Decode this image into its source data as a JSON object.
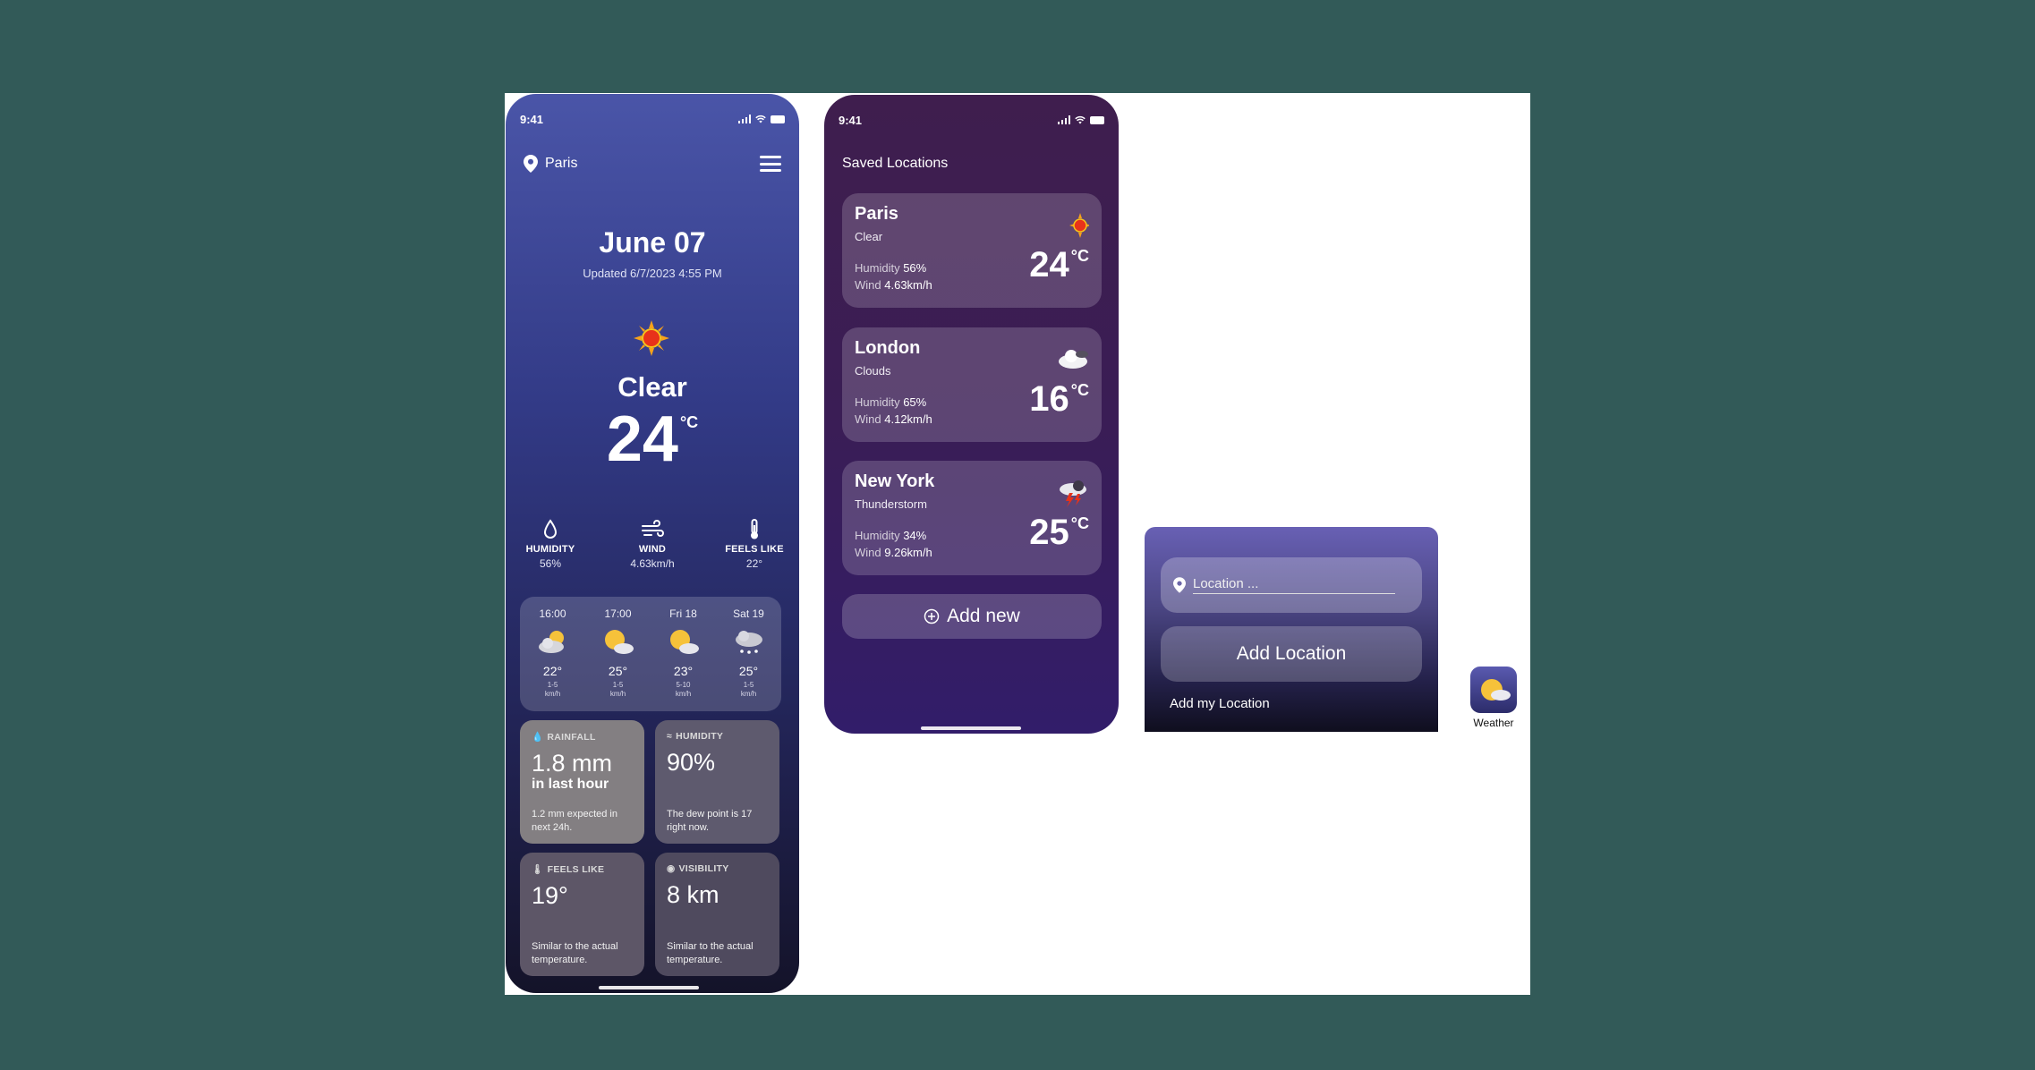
{
  "screen1": {
    "status_time": "9:41",
    "location": "Paris",
    "date": "June 07",
    "updated": "Updated 6/7/2023 4:55 PM",
    "condition": "Clear",
    "temperature": "24",
    "unit": "°C",
    "stats": [
      {
        "label": "HUMIDITY",
        "value": "56%",
        "icon": "droplet-icon"
      },
      {
        "label": "WIND",
        "value": "4.63km/h",
        "icon": "wind-icon"
      },
      {
        "label": "FEELS LIKE",
        "value": "22°",
        "icon": "thermometer-icon"
      }
    ],
    "forecast": [
      {
        "time": "16:00",
        "temp": "22°",
        "wind_value": "1-5",
        "wind_unit": "km/h",
        "icon": "partly-cloudy-icon"
      },
      {
        "time": "17:00",
        "temp": "25°",
        "wind_value": "1-5",
        "wind_unit": "km/h",
        "icon": "sun-behind-cloud-icon"
      },
      {
        "time": "Fri 18",
        "temp": "23°",
        "wind_value": "5-10",
        "wind_unit": "km/h",
        "icon": "sun-behind-cloud-icon"
      },
      {
        "time": "Sat 19",
        "temp": "25°",
        "wind_value": "1-5",
        "wind_unit": "km/h",
        "icon": "snow-cloud-icon"
      }
    ],
    "tiles": {
      "rainfall": {
        "label": "RAINFALL",
        "value": "1.8 mm",
        "sub": "in last hour",
        "foot": "1.2 mm expected in next 24h."
      },
      "humidity": {
        "label": "HUMIDITY",
        "value": "90%",
        "foot": "The dew point is 17 right now."
      },
      "feels_like": {
        "label": "FEELS LIKE",
        "value": "19°",
        "foot": "Similar to the actual temperature."
      },
      "visibility": {
        "label": "VISIBILITY",
        "value": "8 km",
        "foot": "Similar to the actual temperature."
      }
    }
  },
  "screen2": {
    "status_time": "9:41",
    "title": "Saved Locations",
    "cards": [
      {
        "city": "Paris",
        "condition": "Clear",
        "humidity_label": "Humidity",
        "humidity": "56%",
        "wind_label": "Wind",
        "wind": "4.63km/h",
        "temp": "24",
        "unit": "°C",
        "icon": "sun-icon"
      },
      {
        "city": "London",
        "condition": "Clouds",
        "humidity_label": "Humidity",
        "humidity": "65%",
        "wind_label": "Wind",
        "wind": "4.12km/h",
        "temp": "16",
        "unit": "°C",
        "icon": "cloud-icon"
      },
      {
        "city": "New York",
        "condition": "Thunderstorm",
        "humidity_label": "Humidity",
        "humidity": "34%",
        "wind_label": "Wind",
        "wind": "9.26km/h",
        "temp": "25",
        "unit": "°C",
        "icon": "thunderstorm-icon"
      }
    ],
    "add_new_label": "Add new"
  },
  "panel": {
    "input_placeholder": "Location ...",
    "add_button": "Add Location",
    "add_my_location": "Add my Location"
  },
  "app_icon": {
    "label": "Weather",
    "icon": "sun-behind-cloud-icon"
  },
  "colors": {
    "background": "#325a58",
    "phone1_top": "#4a55a8",
    "phone2_bg": "#3a1d55",
    "sun": "#f6c23a"
  }
}
